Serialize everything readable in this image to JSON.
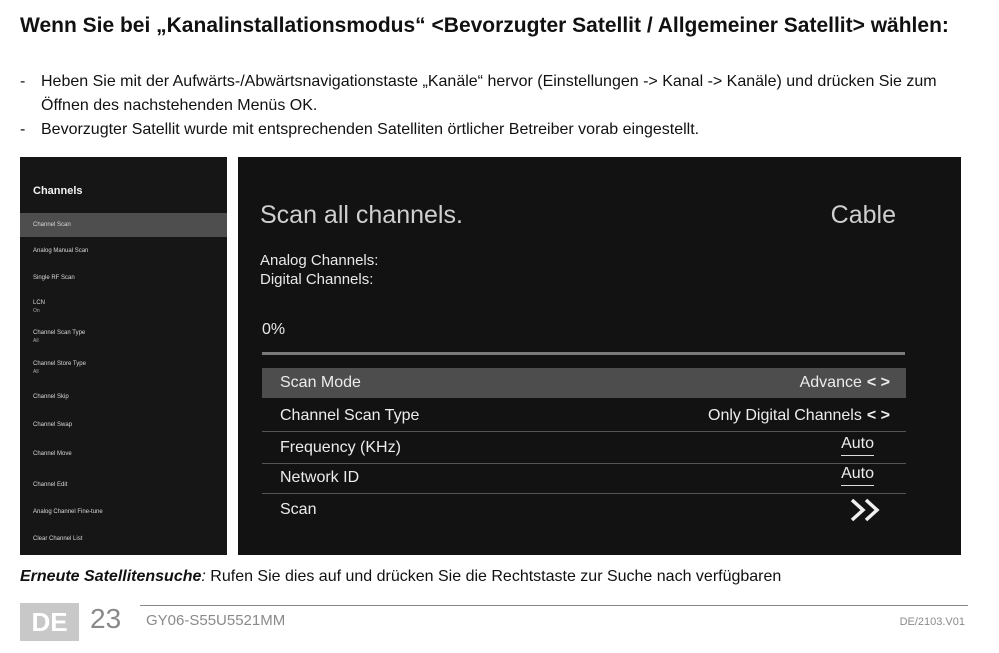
{
  "heading": "Wenn Sie bei „Kanalinstallationsmodus“ <Bevorzugter Satellit / Allgemeiner Satellit> wählen:",
  "bullets": [
    "Heben Sie mit der Aufwärts-/Abwärtsnavigationstaste „Kanäle“ hervor (Einstellungen -> Kanal -> Kanäle) und drücken Sie zum Öffnen des nachstehenden Menüs OK.",
    "Bevorzugter Satellit wurde mit entsprechenden Satelliten örtlicher Betreiber vorab eingestellt."
  ],
  "bullet_dash": "-",
  "menu": {
    "title": "Channels",
    "items": [
      {
        "label": "Channel Scan",
        "sub": "",
        "selected": true
      },
      {
        "label": "Analog Manual Scan",
        "sub": ""
      },
      {
        "label": "Single RF Scan",
        "sub": ""
      },
      {
        "label": "LCN",
        "sub": "On"
      },
      {
        "label": "Channel Scan Type",
        "sub": "All"
      },
      {
        "label": "Channel Store Type",
        "sub": "All"
      },
      {
        "label": "Channel Skip",
        "sub": ""
      },
      {
        "label": "Channel Swap",
        "sub": ""
      },
      {
        "label": "Channel Move",
        "sub": ""
      },
      {
        "label": "Channel Edit",
        "sub": ""
      },
      {
        "label": "Analog Channel Fine-tune",
        "sub": ""
      },
      {
        "label": "Clear Channel List",
        "sub": ""
      }
    ]
  },
  "screen": {
    "title": "Scan all channels.",
    "source": "Cable",
    "analog_label": "Analog Channels:",
    "digital_label": "Digital Channels:",
    "progress_text": "0%",
    "progress_value": 0,
    "rows": [
      {
        "name": "Scan Mode",
        "value": "Advance",
        "arrows": "< >",
        "selected": true
      },
      {
        "name": "Channel Scan Type",
        "value": "Only Digital Channels",
        "arrows": "< >"
      },
      {
        "name": "Frequency (KHz)",
        "value": "Auto"
      },
      {
        "name": "Network ID",
        "value": "Auto"
      },
      {
        "name": "Scan",
        "icon": "double-chevron-right-icon"
      }
    ]
  },
  "footer": {
    "emphasis": "Erneute Satellitensuche",
    "colon": ":",
    "text": " Rufen Sie dies auf und drücken Sie die Rechtstaste zur Suche nach verfügbaren",
    "lang": "DE",
    "page": "23",
    "model": "GY06-S55U5521MM",
    "version": "DE/2103.V01"
  }
}
